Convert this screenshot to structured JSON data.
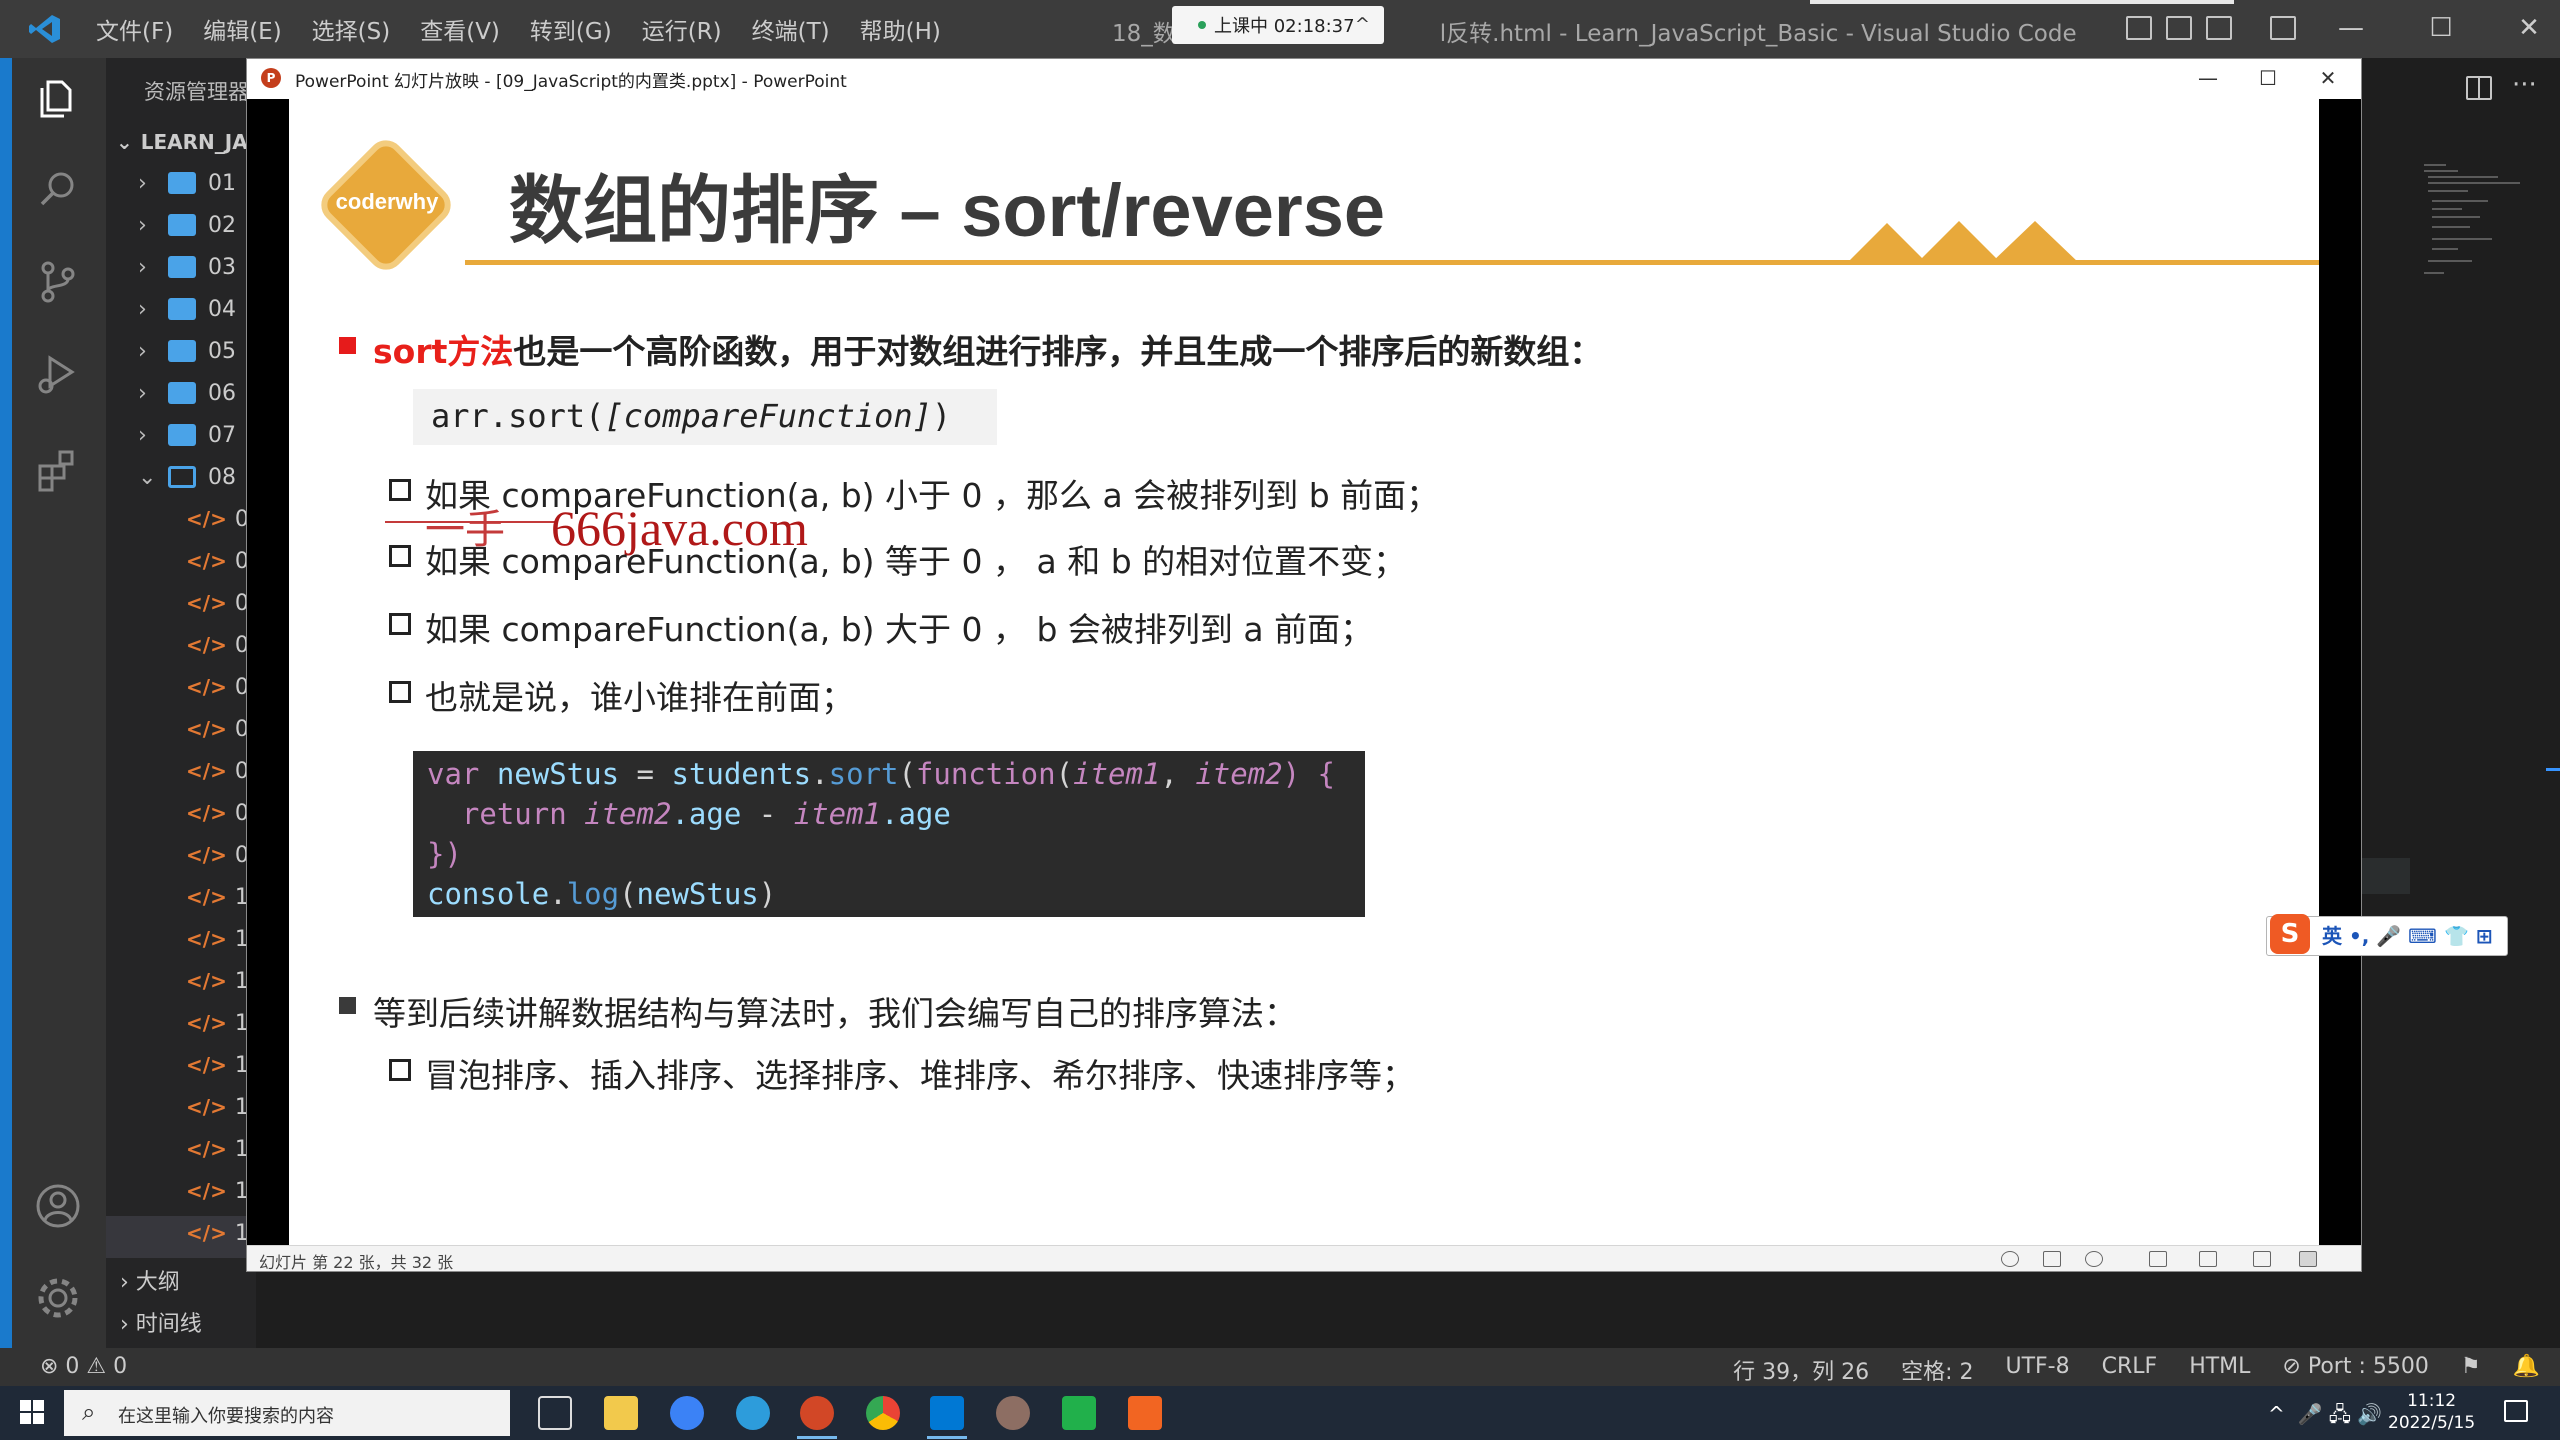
{
  "vscode": {
    "menu": [
      "文件(F)",
      "编辑(E)",
      "选择(S)",
      "查看(V)",
      "转到(G)",
      "运行(R)",
      "终端(T)",
      "帮助(H)"
    ],
    "title_prefix": "18_数",
    "title_suffix": "l反转.html - Learn_JavaScript_Basic - Visual Studio Code",
    "timer": "上课中 02:18:37",
    "explorer_title": "资源管理器",
    "explorer_root": "LEARN_JA",
    "folders": [
      "01",
      "02",
      "03",
      "04",
      "05",
      "06",
      "07",
      "08"
    ],
    "file_labels": [
      "0",
      "0",
      "0",
      "0",
      "0",
      "0",
      "0",
      "0",
      "0",
      "1",
      "1",
      "1",
      "1",
      "1",
      "1",
      "1",
      "1",
      "1"
    ],
    "outline": "大纲",
    "timeline": "时间线",
    "status": {
      "problems": "⊗ 0 ⚠ 0",
      "position": "行 39，列 26",
      "spaces": "空格: 2",
      "encoding": "UTF-8",
      "eol": "CRLF",
      "language": "HTML",
      "port": "⊘ Port : 5500"
    }
  },
  "ppt": {
    "window_title": "PowerPoint 幻灯片放映 - [09_JavaScript的内置类.pptx] - PowerPoint",
    "status": "幻灯片 第 22 张，共 32 张",
    "slide": {
      "logo": "coderwhy",
      "title": "数组的排序 – sort/reverse",
      "bullet1_highlight": "sort方法",
      "bullet1_rest": "也是一个高阶函数，用于对数组进行排序，并且生成一个排序后的新数组：",
      "signature_plain": "arr.sort(",
      "signature_param": "[compareFunction]",
      "signature_close": ")",
      "subpoints": [
        "如果 compareFunction(a, b) 小于 0 ，那么 a 会被排列到 b 前面；",
        "如果 compareFunction(a, b) 等于 0 ， a 和 b 的相对位置不变；",
        "如果 compareFunction(a, b) 大于 0 ， b 会被排列到 a 前面；",
        "也就是说，谁小谁排在前面；"
      ],
      "code": {
        "l1_var": "var ",
        "l1_name": "newStus",
        "l1_eq": " = ",
        "l1_obj": "students",
        "l1_dot": ".",
        "l1_sort": "sort",
        "l1_open": "(",
        "l1_function": "function",
        "l1_paren": "(",
        "l1_p1": "item1",
        "l1_comma": ", ",
        "l1_p2": "item2",
        "l1_close": ") {",
        "l2_return": "  return ",
        "l2_p2": "item2",
        "l2_age1": ".age",
        "l2_minus": " - ",
        "l2_p1": "item1",
        "l2_age2": ".age",
        "l3": "})",
        "l4_console": "console",
        "l4_dot": ".",
        "l4_log": "log",
        "l4_open": "(",
        "l4_arg": "newStus",
        "l4_close": ")"
      },
      "bullet2": "等到后续讲解数据结构与算法时，我们会编写自己的排序算法：",
      "subpoint2": "冒泡排序、插入排序、选择排序、堆排序、希尔排序、快速排序等；",
      "watermark": "666java.com",
      "watermark_prefix": "一手"
    }
  },
  "ime": {
    "text": "英 •, 🎤 ⌨ 👕 ⊞",
    "logo": "S"
  },
  "taskbar": {
    "search_placeholder": "在这里输入你要搜索的内容",
    "time": "11:12",
    "date": "2022/5/15"
  },
  "colors": {
    "accent_orange": "#e8a93b",
    "bullet_red": "#e61b1b",
    "vscode_blue": "#1a7acc"
  }
}
